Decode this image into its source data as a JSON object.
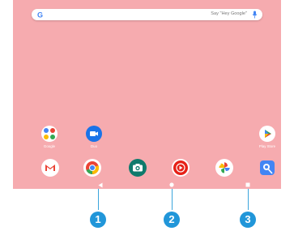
{
  "search": {
    "hint": "Say \"Hey Google\"",
    "logo": "G"
  },
  "home_apps": [
    {
      "name": "google-folder",
      "label": "Google"
    },
    {
      "name": "duo",
      "label": "Duo"
    },
    {
      "name": "play-store",
      "label": "Play Store"
    }
  ],
  "dock_apps": [
    "gmail-icon",
    "chrome-icon",
    "camera-icon",
    "youtube-music-icon",
    "photos-icon",
    "maps-icon"
  ],
  "callouts": [
    "1",
    "2",
    "3"
  ],
  "colors": {
    "wallpaper": "#f6abaf",
    "callout": "#2196d9"
  }
}
